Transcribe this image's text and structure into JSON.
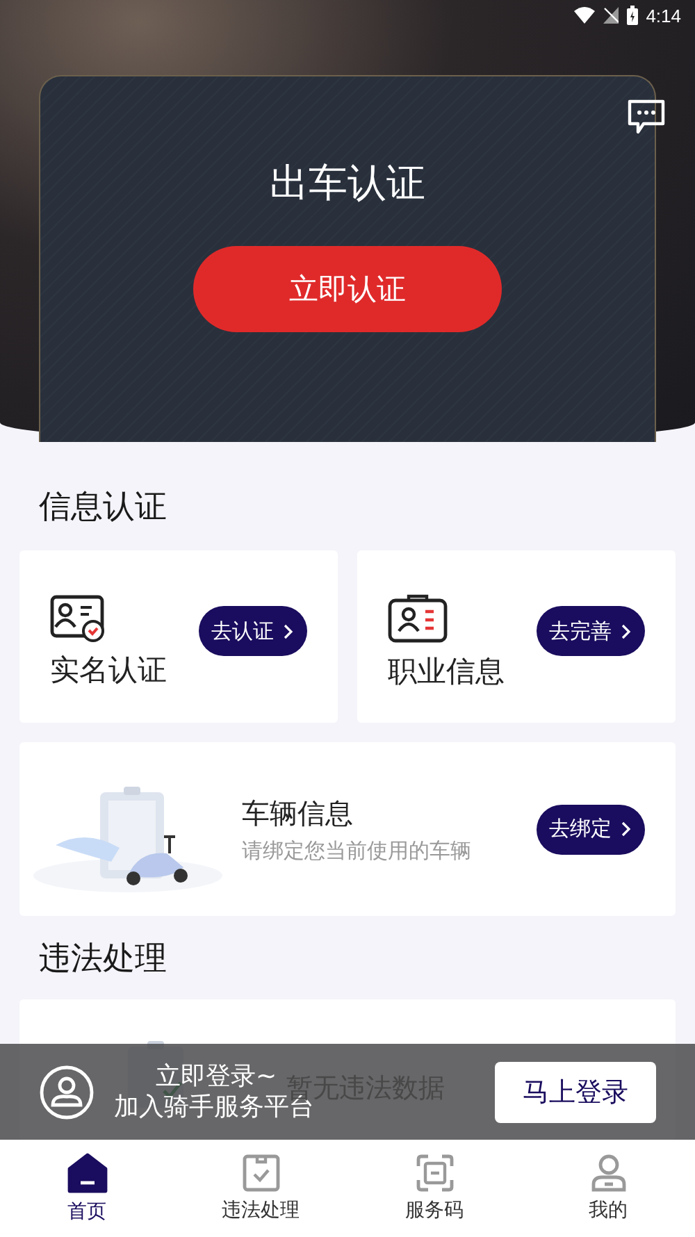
{
  "status_bar": {
    "time": "4:14"
  },
  "hero": {
    "title": "出车认证",
    "button": "立即认证"
  },
  "info_section": {
    "title": "信息认证",
    "cards": [
      {
        "kind": "idcard",
        "title": "实名认证",
        "button": "去认证"
      },
      {
        "kind": "badge",
        "title": "职业信息",
        "button": "去完善"
      }
    ],
    "vehicle": {
      "title": "车辆信息",
      "subtitle": "请绑定您当前使用的车辆",
      "button": "去绑定"
    }
  },
  "violations": {
    "title": "违法处理",
    "empty_text": "暂无违法数据"
  },
  "login_banner": {
    "line1": "立即登录~",
    "line2": "加入骑手服务平台",
    "button": "马上登录"
  },
  "tabs": [
    {
      "kind": "home",
      "label": "首页",
      "selected": true
    },
    {
      "kind": "violations",
      "label": "违法处理",
      "selected": false
    },
    {
      "kind": "code",
      "label": "服务码",
      "selected": false
    },
    {
      "kind": "profile",
      "label": "我的",
      "selected": false
    }
  ]
}
